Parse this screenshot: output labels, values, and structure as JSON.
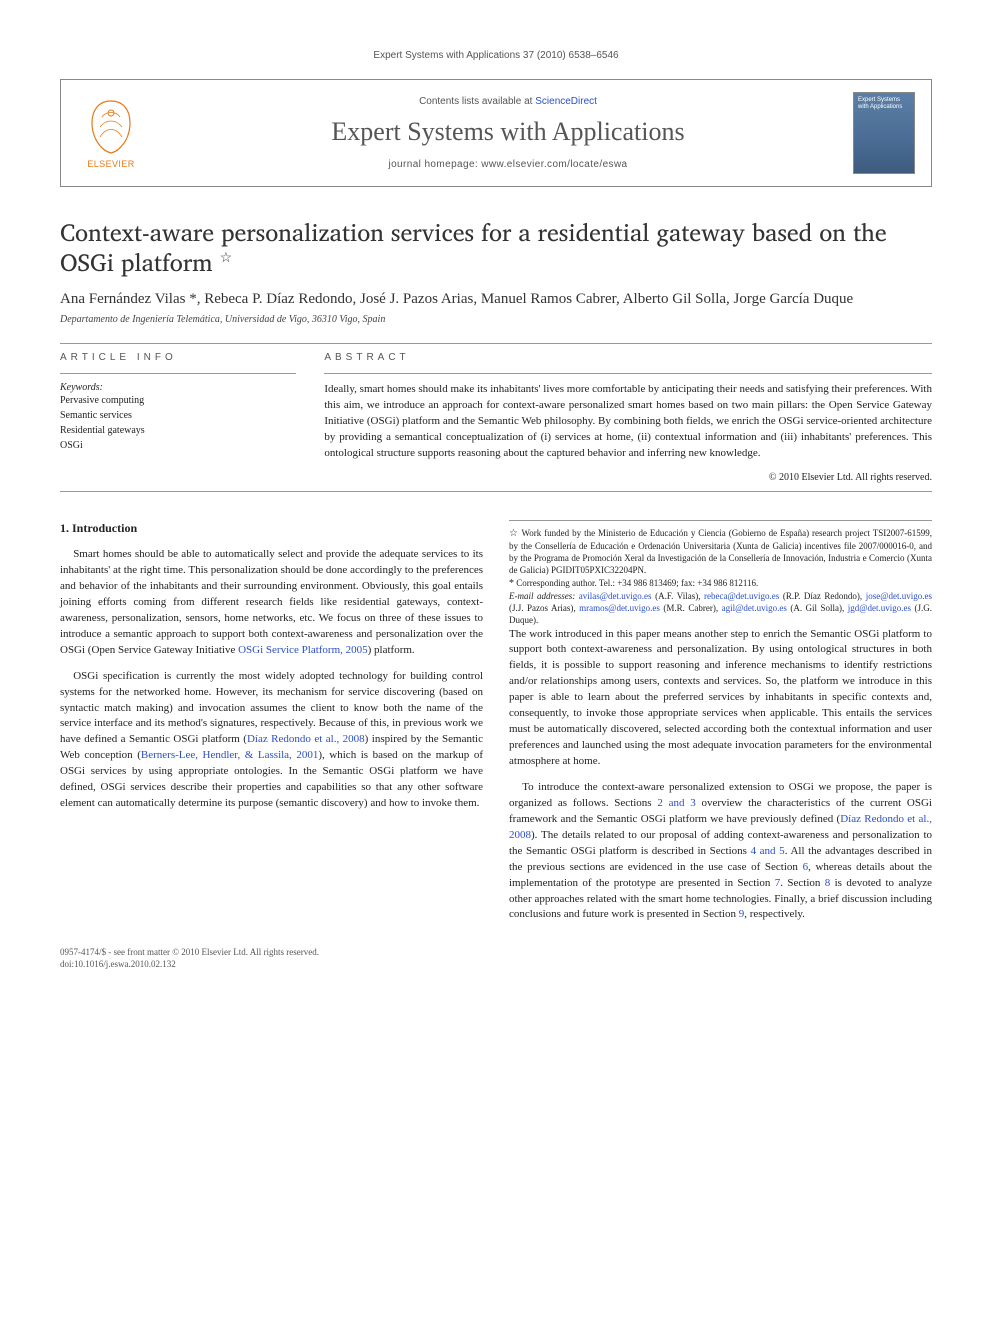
{
  "header": {
    "running_head": "Expert Systems with Applications 37 (2010) 6538–6546"
  },
  "journal_box": {
    "contents_prefix": "Contents lists available at ",
    "contents_link": "ScienceDirect",
    "journal_title": "Expert Systems with Applications",
    "homepage_label": "journal homepage: www.elsevier.com/locate/eswa",
    "publisher": "ELSEVIER",
    "cover_text": "Expert Systems with Applications"
  },
  "article": {
    "title": "Context-aware personalization services for a residential gateway based on the OSGi platform",
    "title_note_mark": "☆",
    "authors_html": "Ana Fernández Vilas *, Rebeca P. Díaz Redondo, José J. Pazos Arias, Manuel Ramos Cabrer, Alberto Gil Solla, Jorge García Duque",
    "affiliation": "Departamento de Ingeniería Telemática, Universidad de Vigo, 36310 Vigo, Spain"
  },
  "info": {
    "section_label": "ARTICLE INFO",
    "keywords_label": "Keywords:",
    "keywords": [
      "Pervasive computing",
      "Semantic services",
      "Residential gateways",
      "OSGi"
    ]
  },
  "abstract": {
    "section_label": "ABSTRACT",
    "text": "Ideally, smart homes should make its inhabitants' lives more comfortable by anticipating their needs and satisfying their preferences. With this aim, we introduce an approach for context-aware personalized smart homes based on two main pillars: the Open Service Gateway Initiative (OSGi) platform and the Semantic Web philosophy. By combining both fields, we enrich the OSGi service-oriented architecture by providing a semantical conceptualization of (i) services at home, (ii) contextual information and (iii) inhabitants' preferences. This ontological structure supports reasoning about the captured behavior and inferring new knowledge.",
    "copyright": "© 2010 Elsevier Ltd. All rights reserved."
  },
  "body": {
    "h_intro": "1. Introduction",
    "p1": "Smart homes should be able to automatically select and provide the adequate services to its inhabitants' at the right time. This personalization should be done accordingly to the preferences and behavior of the inhabitants and their surrounding environment. Obviously, this goal entails joining efforts coming from different research fields like residential gateways, context-awareness, personalization, sensors, home networks, etc. We focus on three of these issues to introduce a semantic approach to support both context-awareness and personalization over the OSGi (Open Service Gateway Initiative ",
    "p1_ref": "OSGi Service Platform, 2005",
    "p1_tail": ") platform.",
    "p2": "OSGi specification is currently the most widely adopted technology for building control systems for the networked home. However, its mechanism for service discovering (based on syntactic match making) and invocation assumes the client to know both the name of the service interface and its method's signatures, respectively. Because of this, in previous work we have defined a Semantic OSGi platform (",
    "p2_ref1": "Díaz Redondo et al., 2008",
    "p2_mid": ") inspired by the Semantic Web conception (",
    "p2_ref2": "Berners-Lee, Hendler, & Lassila, 2001",
    "p2_tail": "), which is based on the markup of OSGi services by using appropriate ontologies. In the Semantic OSGi platform we have defined, OSGi services describe their properties and capabilities so that any other software element can automatically determine its purpose (semantic discovery) and how to invoke them.",
    "p3": "The work introduced in this paper means another step to enrich the Semantic OSGi platform to support both context-awareness and personalization. By using ontological structures in both fields, it is possible to support reasoning and inference mechanisms to identify restrictions and/or relationships among users, contexts and services. So, the platform we introduce in this paper is able to learn about the preferred services by inhabitants in specific contexts and, consequently, to invoke those appropriate services when applicable. This entails the services must be automatically discovered, selected according both the contextual information and user preferences and launched using the most adequate invocation parameters for the environmental atmosphere at home.",
    "p4a": "To introduce the context-aware personalized extension to OSGi we propose, the paper is organized as follows. Sections ",
    "p4_ref1": "2 and 3",
    "p4b": " overview the characteristics of the current OSGi framework and the Semantic OSGi platform we have previously defined (",
    "p4_ref2": "Díaz Redondo et al., 2008",
    "p4c": "). The details related to our proposal of adding context-awareness and personalization to the Semantic OSGi platform is described in Sections ",
    "p4_ref3": "4 and 5",
    "p4d": ". All the advantages described in the previous sections are evidenced in the use case of Section ",
    "p4_ref4": "6",
    "p4e": ", whereas details about the implementation of the prototype are presented in Section ",
    "p4_ref5": "7",
    "p4f": ". Section ",
    "p4_ref6": "8",
    "p4g": " is devoted to analyze other approaches related with the smart home technologies. Finally, a brief discussion including conclusions and future work is presented in Section ",
    "p4_ref7": "9",
    "p4h": ", respectively."
  },
  "footnotes": {
    "funding_mark": "☆",
    "funding": "Work funded by the Ministerio de Educación y Ciencia (Gobierno de España) research project TSI2007-61599, by the Consellería de Educación e Ordenación Universitaria (Xunta de Galicia) incentives file 2007/000016-0, and by the Programa de Promoción Xeral da Investigación de la Consellería de Innovación, Industria e Comercio (Xunta de Galicia) PGIDIT05PXIC32204PN.",
    "corr_mark": "*",
    "corr": "Corresponding author. Tel.: +34 986 813469; fax: +34 986 812116.",
    "emails_label": "E-mail addresses: ",
    "emails": [
      {
        "addr": "avilas@det.uvigo.es",
        "who": "(A.F. Vilas)"
      },
      {
        "addr": "rebeca@det.uvigo.es",
        "who": "(R.P. Díaz Redondo)"
      },
      {
        "addr": "jose@det.uvigo.es",
        "who": "(J.J. Pazos Arias)"
      },
      {
        "addr": "mramos@det.uvigo.es",
        "who": "(M.R. Cabrer)"
      },
      {
        "addr": "agil@det.uvigo.es",
        "who": "(A. Gil Solla)"
      },
      {
        "addr": "jgd@det.uvigo.es",
        "who": "(J.G. Duque)"
      }
    ]
  },
  "doi": {
    "line1": "0957-4174/$ - see front matter © 2010 Elsevier Ltd. All rights reserved.",
    "line2": "doi:10.1016/j.eswa.2010.02.132"
  }
}
